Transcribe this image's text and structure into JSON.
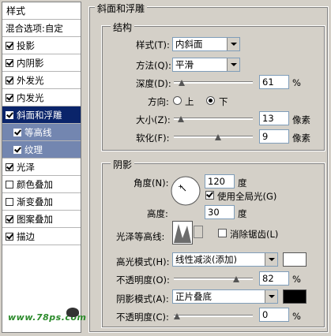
{
  "style_list": {
    "header": "样式",
    "blend_options": "混合选项:自定",
    "items": [
      {
        "label": "投影",
        "checked": true
      },
      {
        "label": "内阴影",
        "checked": true
      },
      {
        "label": "外发光",
        "checked": true
      },
      {
        "label": "内发光",
        "checked": true
      },
      {
        "label": "斜面和浮雕",
        "checked": true,
        "selected": true
      },
      {
        "label": "等高线",
        "checked": true,
        "sub": true
      },
      {
        "label": "纹理",
        "checked": true,
        "sub": true
      },
      {
        "label": "光泽",
        "checked": true
      },
      {
        "label": "颜色叠加",
        "checked": false
      },
      {
        "label": "渐变叠加",
        "checked": false
      },
      {
        "label": "图案叠加",
        "checked": true
      },
      {
        "label": "描边",
        "checked": true
      }
    ],
    "watermark": "www.78ps.com"
  },
  "bevel": {
    "title": "斜面和浮雕",
    "structure": {
      "title": "结构",
      "style_label": "样式(T):",
      "style_value": "内斜面",
      "technique_label": "方法(Q):",
      "technique_value": "平滑",
      "depth_label": "深度(D):",
      "depth_value": "61",
      "depth_unit": "%",
      "depth_fraction": 0.061,
      "direction_label": "方向:",
      "direction_up": "上",
      "direction_down": "下",
      "size_label": "大小(Z):",
      "size_value": "13",
      "size_unit": "像素",
      "size_fraction": 0.052,
      "soften_label": "软化(F):",
      "soften_value": "9",
      "soften_unit": "像素",
      "soften_fraction": 0.56
    },
    "shading": {
      "title": "阴影",
      "angle_label": "角度(N):",
      "angle_value": "120",
      "angle_unit": "度",
      "global_light_label": "使用全局光(G)",
      "altitude_label": "高度:",
      "altitude_value": "30",
      "altitude_unit": "度",
      "gloss_label": "光泽等高线:",
      "anti_alias_label": "消除锯齿(L)",
      "highlight_mode_label": "高光模式(H):",
      "highlight_mode_value": "线性减淡(添加)",
      "highlight_color": "#ffffff",
      "highlight_opacity_label": "不透明度(O):",
      "highlight_opacity_value": "82",
      "highlight_opacity_unit": "%",
      "highlight_opacity_fraction": 0.82,
      "shadow_mode_label": "阴影模式(A):",
      "shadow_mode_value": "正片叠底",
      "shadow_color": "#000000",
      "shadow_opacity_label": "不透明度(C):",
      "shadow_opacity_value": "0",
      "shadow_opacity_unit": "%",
      "shadow_opacity_fraction": 0.0
    }
  }
}
